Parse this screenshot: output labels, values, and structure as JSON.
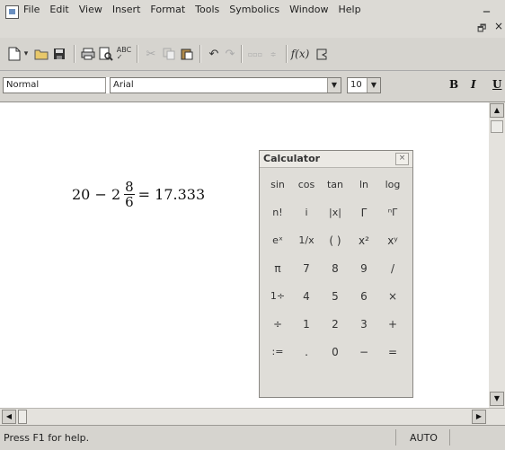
{
  "menu": {
    "items": [
      "File",
      "Edit",
      "View",
      "Insert",
      "Format",
      "Tools",
      "Symbolics",
      "Window",
      "Help"
    ],
    "min_glyph": "_",
    "restore_glyph": "🗗",
    "close_glyph": "×"
  },
  "toolbar": {
    "icons": [
      "new-icon",
      "dropdown-arrow-icon",
      "open-icon",
      "save-icon",
      "print-icon",
      "print-preview-icon",
      "spell-check-icon",
      "cut-icon",
      "copy-icon",
      "paste-icon",
      "undo-icon",
      "redo-icon",
      "align-across-icon",
      "align-down-icon",
      "insert-function-icon",
      "insert-unit-icon"
    ]
  },
  "format": {
    "style": "Normal",
    "font": "Arial",
    "size": "10",
    "bold_label": "B",
    "italic_label": "I",
    "underline_label": "U"
  },
  "worksheet": {
    "expr_left": "20 − 2",
    "frac_num": "8",
    "frac_den": "6",
    "expr_right": "= 17.333"
  },
  "calculator": {
    "title": "Calculator",
    "close_glyph": "×",
    "keys": [
      "sin",
      "cos",
      "tan",
      "ln",
      "log",
      "n!",
      "i",
      "|x|",
      "Γ",
      "ⁿΓ",
      "eˣ",
      "1/x",
      "( )",
      "x²",
      "xʸ",
      "π",
      "7",
      "8",
      "9",
      "/",
      "1÷",
      "4",
      "5",
      "6",
      "×",
      "÷",
      "1",
      "2",
      "3",
      "+",
      ":=",
      ".",
      "0",
      "−",
      "="
    ]
  },
  "status": {
    "help_text": "Press F1 for help.",
    "mode": "AUTO"
  }
}
